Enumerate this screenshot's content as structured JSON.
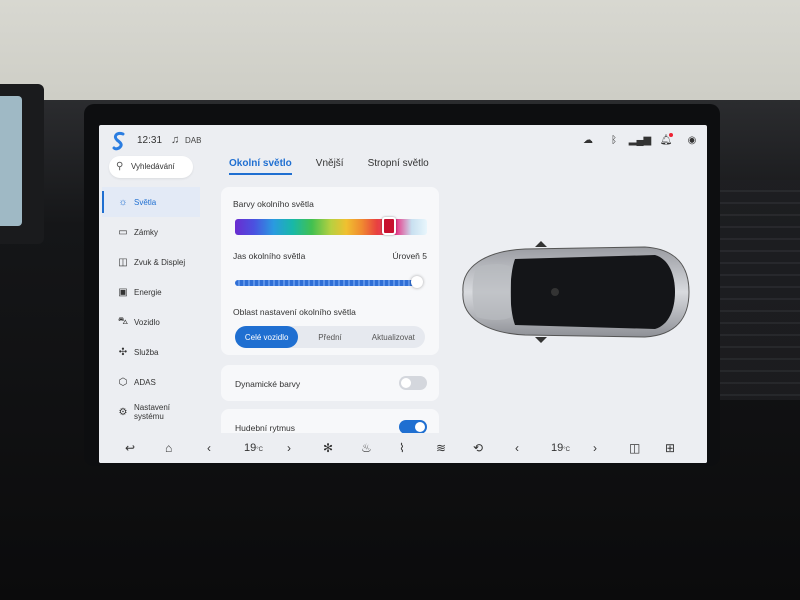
{
  "status": {
    "time": "12:31",
    "source": "DAB",
    "icons": [
      "lock-cloud-icon",
      "bluetooth-icon",
      "signal-icon",
      "bell-icon",
      "profile-icon"
    ]
  },
  "search": {
    "placeholder": "Vyhledávání"
  },
  "sidebar": {
    "items": [
      {
        "label": "Světla",
        "icon": "sun-icon",
        "active": true
      },
      {
        "label": "Zámky",
        "icon": "door-icon"
      },
      {
        "label": "Zvuk & Displej",
        "icon": "speaker-icon"
      },
      {
        "label": "Energie",
        "icon": "battery-icon"
      },
      {
        "label": "Vozidlo",
        "icon": "car-icon"
      },
      {
        "label": "Služba",
        "icon": "service-icon"
      },
      {
        "label": "ADAS",
        "icon": "adas-icon"
      },
      {
        "label": "Nastavení systému",
        "icon": "settings-icon"
      }
    ]
  },
  "tabs": [
    {
      "label": "Okolní světlo",
      "active": true
    },
    {
      "label": "Vnější"
    },
    {
      "label": "Stropní světlo"
    }
  ],
  "ambient": {
    "color_label": "Barvy okolního světla",
    "color_selected": "#c8102e",
    "color_position": 0.8,
    "brightness_label": "Jas okolního světla",
    "brightness_value": "Úroveň 5",
    "brightness_fraction": 1.0,
    "area_label": "Oblast nastavení okolního světla",
    "area_options": [
      "Celé vozidlo",
      "Přední",
      "Aktualizovat"
    ],
    "area_selected": 0
  },
  "dynamic_colors": {
    "label": "Dynamické barvy",
    "on": false
  },
  "music_rhythm": {
    "label": "Hudební rytmus",
    "on": true
  },
  "bottom": {
    "left_temp": "19",
    "right_temp": "19",
    "unit": "°C",
    "icons": [
      "back-icon",
      "home-icon",
      "chevron-left-icon",
      "chevron-right-icon",
      "fan-icon",
      "seat-heat-icon",
      "seat-vent-icon",
      "defrost-front-icon",
      "recirculation-icon",
      "chevron-left-icon",
      "chevron-right-icon",
      "split-screen-icon",
      "apps-grid-icon"
    ]
  },
  "colors": {
    "accent": "#1f6fd1",
    "background": "#eceef2",
    "card": "#f7f8fa"
  }
}
